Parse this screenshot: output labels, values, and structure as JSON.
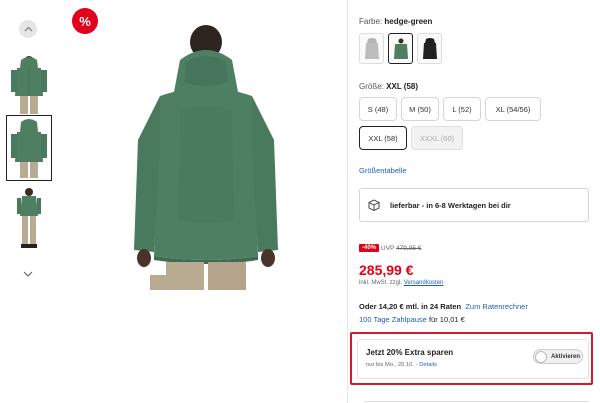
{
  "product": {
    "sale_badge": "%",
    "color_label": "Farbe:",
    "color_value": "hedge-green",
    "size_label": "Größe:",
    "size_value": "XXL (58)",
    "sizes": [
      "S (48)",
      "M (50)",
      "L (52)",
      "XL (54/56)",
      "XXL (58)",
      "XXXL (60)"
    ],
    "size_table_link": "Größentabelle",
    "delivery_text": "lieferbar - in 6-8 Werktagen bei dir",
    "discount_badge": "-40%",
    "uvp_label": "UVP",
    "uvp_price": "479,95 €",
    "price": "285,99 €",
    "tax_note": "inkl. MwSt. zzgl.",
    "shipping_link": "Versandkosten",
    "installment_prefix": "Oder 14,20 € mtl. in 24 Raten",
    "installment_link": "Zum Ratenrechner",
    "pause_link": "100 Tage Zahlpause",
    "pause_suffix": "für 10,01 €"
  },
  "promo": {
    "title": "Jetzt 20% Extra sparen",
    "subtitle": "nur bis Mo., 20.10. -",
    "details_link": "Details",
    "toggle_label": "Aktivieren"
  },
  "colors": {
    "accent_red": "#e2001a",
    "link_blue": "#1f5fbf",
    "jacket_green": "#4f7f63"
  }
}
